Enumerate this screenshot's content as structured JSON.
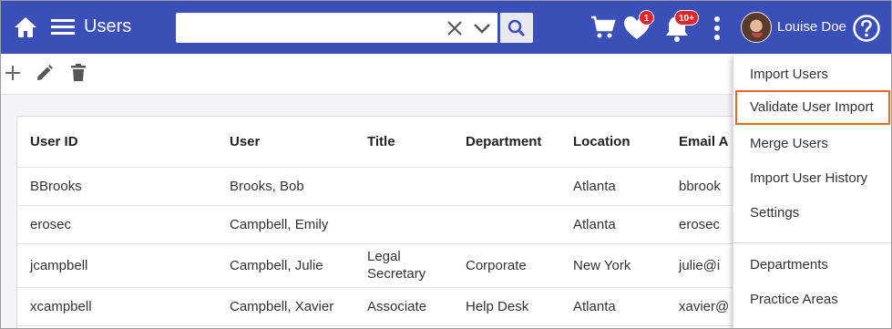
{
  "header": {
    "title": "Users",
    "search": {
      "value": "",
      "placeholder": ""
    },
    "badges": {
      "favorites": "1",
      "notifications": "10+"
    },
    "user_name": "Louise Doe",
    "bg_color": "#3b4fb8"
  },
  "toolbar": {
    "icons": [
      "plus-icon",
      "pencil-icon",
      "trash-icon"
    ]
  },
  "table": {
    "columns": [
      "User ID",
      "User",
      "Title",
      "Department",
      "Location",
      "Email A"
    ],
    "rows": [
      [
        "BBrooks",
        "Brooks, Bob",
        "",
        "",
        "Atlanta",
        "bbrook"
      ],
      [
        "erosec",
        "Campbell, Emily",
        "",
        "",
        "Atlanta",
        "erosec"
      ],
      [
        "jcampbell",
        "Campbell, Julie",
        "Legal Secretary",
        "Corporate",
        "New York",
        "julie@i"
      ],
      [
        "xcampbell",
        "Campbell, Xavier",
        "Associate",
        "Help Desk",
        "Atlanta",
        "xavier@"
      ]
    ],
    "title_line1": "Legal",
    "title_line2": "Secretary"
  },
  "dropdown": {
    "items": [
      "Import Users",
      "Validate User Import",
      "Merge Users",
      "Import User History",
      "Settings",
      "Departments",
      "Practice Areas"
    ],
    "highlighted_index": 1,
    "highlight_color": "#e36c2a"
  }
}
